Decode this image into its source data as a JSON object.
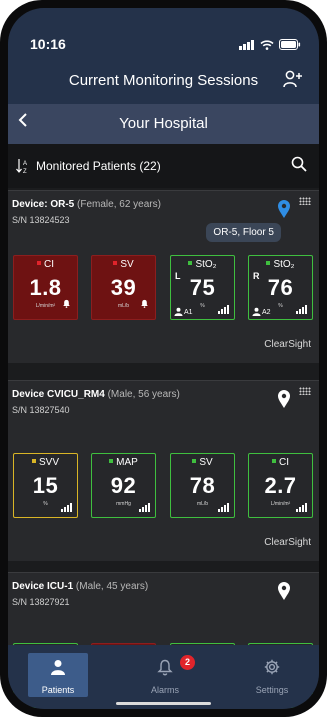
{
  "status_bar": {
    "time": "10:16"
  },
  "header": {
    "title": "Current Monitoring Sessions",
    "add_user_icon": "add-user-icon"
  },
  "subheader": {
    "title": "Your Hospital"
  },
  "toolbar": {
    "label": "Monitored Patients (22)"
  },
  "patients": [
    {
      "device": "Device: OR-5",
      "detail": "(Female, 62 years)",
      "sn": "S/N 13824523",
      "location": "OR-5, Floor 5",
      "pin_color": "#2f8de4",
      "brand": "ClearSight",
      "tiles": [
        {
          "label": "CI",
          "value": "1.8",
          "unit": "L/min/m²",
          "style": "alarm",
          "dot": "#e0242b"
        },
        {
          "label": "SV",
          "value": "39",
          "unit": "mL/b",
          "style": "alarm",
          "dot": "#e0242b"
        },
        {
          "label": "StO₂",
          "value": "75",
          "unit": "%",
          "style": "normal",
          "dot": "#3fbf3f",
          "side": "L",
          "sensor": "A1"
        },
        {
          "label": "StO₂",
          "value": "76",
          "unit": "%",
          "style": "normal",
          "dot": "#3fbf3f",
          "side": "R",
          "sensor": "A2"
        }
      ]
    },
    {
      "device": "Device CVICU_RM4",
      "detail": "(Male, 56 years)",
      "sn": "S/N 13827540",
      "pin_color": "#ffffff",
      "brand": "ClearSight",
      "tiles": [
        {
          "label": "SVV",
          "value": "15",
          "unit": "%",
          "style": "yellow",
          "dot": "#d9b526"
        },
        {
          "label": "MAP",
          "value": "92",
          "unit": "mmHg",
          "style": "normal",
          "dot": "#3fbf3f"
        },
        {
          "label": "SV",
          "value": "78",
          "unit": "mL/b",
          "style": "normal",
          "dot": "#3fbf3f"
        },
        {
          "label": "CI",
          "value": "2.7",
          "unit": "L/min/m²",
          "style": "normal",
          "dot": "#3fbf3f"
        }
      ]
    },
    {
      "device": "Device ICU-1",
      "detail": "(Male, 45 years)",
      "sn": "S/N 13827921",
      "pin_color": "#ffffff"
    }
  ],
  "tabs": [
    {
      "label": "Patients",
      "icon": "person-icon",
      "active": true
    },
    {
      "label": "Alarms",
      "icon": "bell-icon",
      "badge": "2"
    },
    {
      "label": "Settings",
      "icon": "gear-icon"
    }
  ],
  "colors": {
    "header": "#24324a",
    "subheader": "#3a4660",
    "alarm": "#6e1212",
    "ok": "#3fbf3f",
    "warn": "#d9b526",
    "active_tab": "#3d5c8a"
  }
}
